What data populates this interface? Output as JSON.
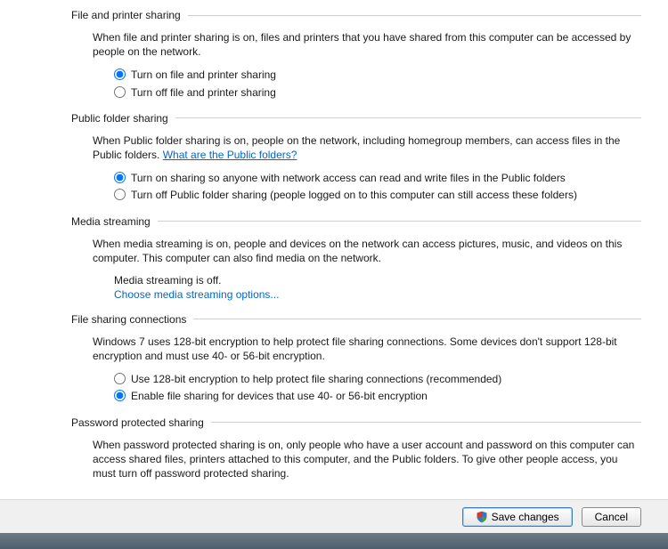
{
  "sections": {
    "filePrinter": {
      "title": "File and printer sharing",
      "desc": "When file and printer sharing is on, files and printers that you have shared from this computer can be accessed by people on the network.",
      "opt_on": "Turn on file and printer sharing",
      "opt_off": "Turn off file and printer sharing"
    },
    "publicFolder": {
      "title": "Public folder sharing",
      "desc_prefix": "When Public folder sharing is on, people on the network, including homegroup members, can access files in the Public folders. ",
      "desc_link": "What are the Public folders?",
      "opt_on": "Turn on sharing so anyone with network access can read and write files in the Public folders",
      "opt_off": "Turn off Public folder sharing (people logged on to this computer can still access these folders)"
    },
    "mediaStreaming": {
      "title": "Media streaming",
      "desc": "When media streaming is on, people and devices on the network can access pictures, music, and videos on this computer. This computer can also find media on the network.",
      "status": "Media streaming is off.",
      "link": "Choose media streaming options..."
    },
    "fileSharingConn": {
      "title": "File sharing connections",
      "desc": "Windows 7 uses 128-bit encryption to help protect file sharing connections. Some devices don't support 128-bit encryption and must use 40- or 56-bit encryption.",
      "opt_128": "Use 128-bit encryption to help protect file sharing connections (recommended)",
      "opt_4056": "Enable file sharing for devices that use 40- or 56-bit encryption"
    },
    "passwordProtected": {
      "title": "Password protected sharing",
      "desc": "When password protected sharing is on, only people who have a user account and password on this computer can access shared files, printers attached to this computer, and the Public folders. To give other people access, you must turn off password protected sharing."
    }
  },
  "footer": {
    "save": "Save changes",
    "cancel": "Cancel"
  }
}
